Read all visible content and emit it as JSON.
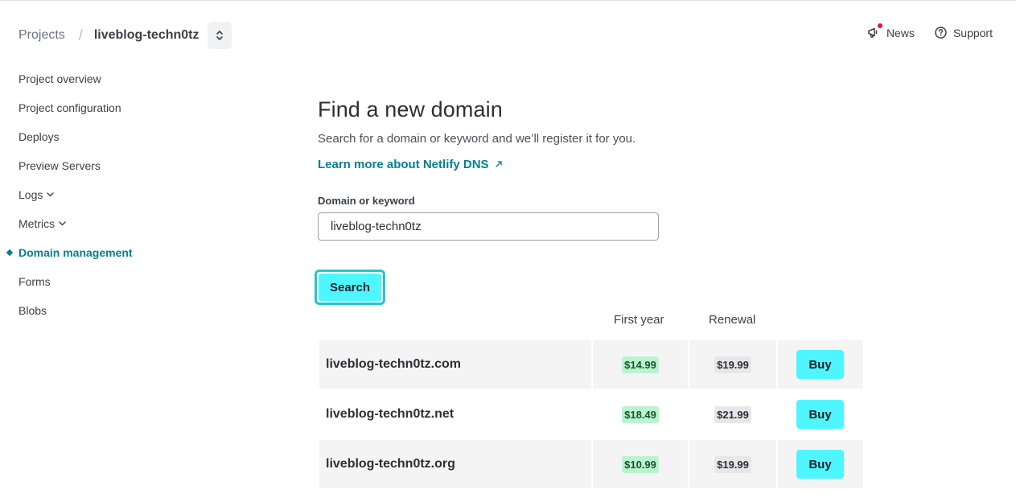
{
  "header": {
    "breadcrumb_root": "Projects",
    "breadcrumb_separator": "/",
    "site_name": "liveblog-techn0tz",
    "links": {
      "news": "News",
      "support": "Support"
    }
  },
  "sidebar": {
    "items": [
      {
        "label": "Project overview",
        "active": false
      },
      {
        "label": "Project configuration",
        "active": false
      },
      {
        "label": "Deploys",
        "active": false
      },
      {
        "label": "Preview Servers",
        "active": false
      },
      {
        "label": "Logs",
        "active": false,
        "expandable": true
      },
      {
        "label": "Metrics",
        "active": false,
        "expandable": true
      },
      {
        "label": "Domain management",
        "active": true
      },
      {
        "label": "Forms",
        "active": false
      },
      {
        "label": "Blobs",
        "active": false
      }
    ]
  },
  "main": {
    "title": "Find a new domain",
    "description": "Search for a domain or keyword and we’ll register it for you.",
    "learn_link": "Learn more about Netlify DNS",
    "field_label": "Domain or keyword",
    "field_value": "liveblog-techn0tz",
    "search_label": "Search"
  },
  "results": {
    "headers": {
      "first_year": "First year",
      "renewal": "Renewal"
    },
    "buy_label": "Buy",
    "rows": [
      {
        "domain": "liveblog-techn0tz.com",
        "first_year": "$14.99",
        "renewal": "$19.99"
      },
      {
        "domain": "liveblog-techn0tz.net",
        "first_year": "$18.49",
        "renewal": "$21.99"
      },
      {
        "domain": "liveblog-techn0tz.org",
        "first_year": "$10.99",
        "renewal": "$19.99"
      }
    ]
  },
  "colors": {
    "accent_teal": "#05808f",
    "button_cyan": "#4ff6ff",
    "focus_ring": "#28c4cc",
    "price_green": "#b9f4cf",
    "news_dot": "#e5132d"
  }
}
